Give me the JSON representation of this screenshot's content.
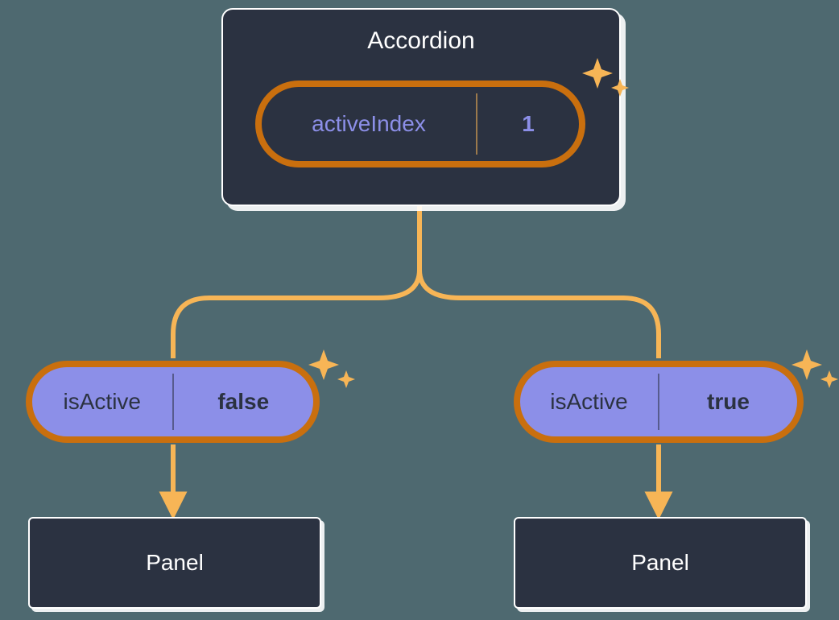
{
  "parent": {
    "title": "Accordion",
    "state_name": "activeIndex",
    "state_value": "1"
  },
  "children": [
    {
      "prop_name": "isActive",
      "prop_value": "false",
      "label": "Panel"
    },
    {
      "prop_name": "isActive",
      "prop_value": "true",
      "label": "Panel"
    }
  ],
  "colors": {
    "bg": "#4e6970",
    "card": "#2b3241",
    "outline": "#ffffff",
    "pill_border": "#c96f0e",
    "pill_light": "#8c8fe8",
    "accent": "#f7b556"
  }
}
